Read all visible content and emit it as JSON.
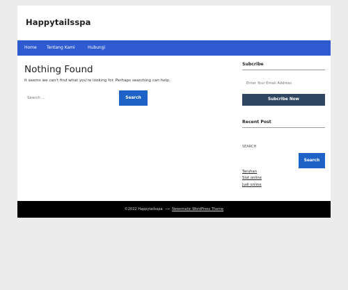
{
  "site": {
    "title": "Happytailsspa"
  },
  "nav": {
    "items": [
      {
        "label": "Home"
      },
      {
        "label": "Tentang Kami"
      },
      {
        "label": "Hubungi"
      }
    ]
  },
  "main": {
    "heading": "Nothing Found",
    "description": "It seems we can't find what you're looking for. Perhaps searching can help.",
    "search": {
      "placeholder": "Search ...",
      "button_label": "Search"
    }
  },
  "sidebar": {
    "subscribe": {
      "title": "Subcribe",
      "email_placeholder": "Enter Your Email Address",
      "button_label": "Subcribe Now"
    },
    "recent_posts": {
      "title": "Recent Post",
      "search_label": "SEARCH",
      "search_button_label": "Search",
      "items": [
        {
          "label": "Taruhan"
        },
        {
          "label": "Slot online"
        },
        {
          "label": "Judi online"
        }
      ]
    }
  },
  "footer": {
    "copyright": "©2022 Happytailsspa",
    "separator": "⟶",
    "theme_credit": "Newsmatic WordPress Theme"
  },
  "colors": {
    "nav_bg": "#2e5cd0",
    "button_blue": "#1e62c8",
    "button_dark": "#2f4660",
    "footer_bg": "#000000",
    "page_bg": "#ececec"
  }
}
